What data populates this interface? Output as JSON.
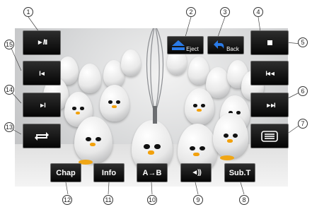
{
  "screen": {
    "scene": "eggs-with-whisk-background"
  },
  "buttons": {
    "play_pause": {
      "icon": "play-pause-icon",
      "glyph": "►/II"
    },
    "prev_chapter": {
      "icon": "skip-previous-icon",
      "glyph": "I◄"
    },
    "next_chapter": {
      "icon": "skip-next-icon",
      "glyph": "►I"
    },
    "repeat": {
      "icon": "repeat-icon"
    },
    "eject": {
      "label": "Eject",
      "icon": "eject-icon"
    },
    "back": {
      "label": "Back",
      "icon": "back-arrow-icon"
    },
    "stop": {
      "icon": "stop-icon"
    },
    "fast_rewind": {
      "icon": "fast-rewind-icon",
      "glyph": "I◄◄"
    },
    "fast_forward": {
      "icon": "fast-forward-icon",
      "glyph": "►►I"
    },
    "menu": {
      "icon": "menu-list-icon"
    },
    "chap": {
      "label": "Chap"
    },
    "info": {
      "label": "Info"
    },
    "ab": {
      "label": "A→B"
    },
    "audio": {
      "icon": "speaker-icon",
      "glyph": "◄))"
    },
    "subt": {
      "label": "Sub.T"
    }
  },
  "callouts": {
    "n1": "1",
    "n2": "2",
    "n3": "3",
    "n4": "4",
    "n5": "5",
    "n6": "6",
    "n7": "7",
    "n8": "8",
    "n9": "9",
    "n10": "10",
    "n11": "11",
    "n12": "12",
    "n13": "13",
    "n14": "14",
    "n15": "15"
  },
  "colors": {
    "button_bg": "#111111",
    "button_border": "#6f6f6f",
    "eject_accent": "#1f6fe0",
    "beak": "#f2a10c"
  }
}
